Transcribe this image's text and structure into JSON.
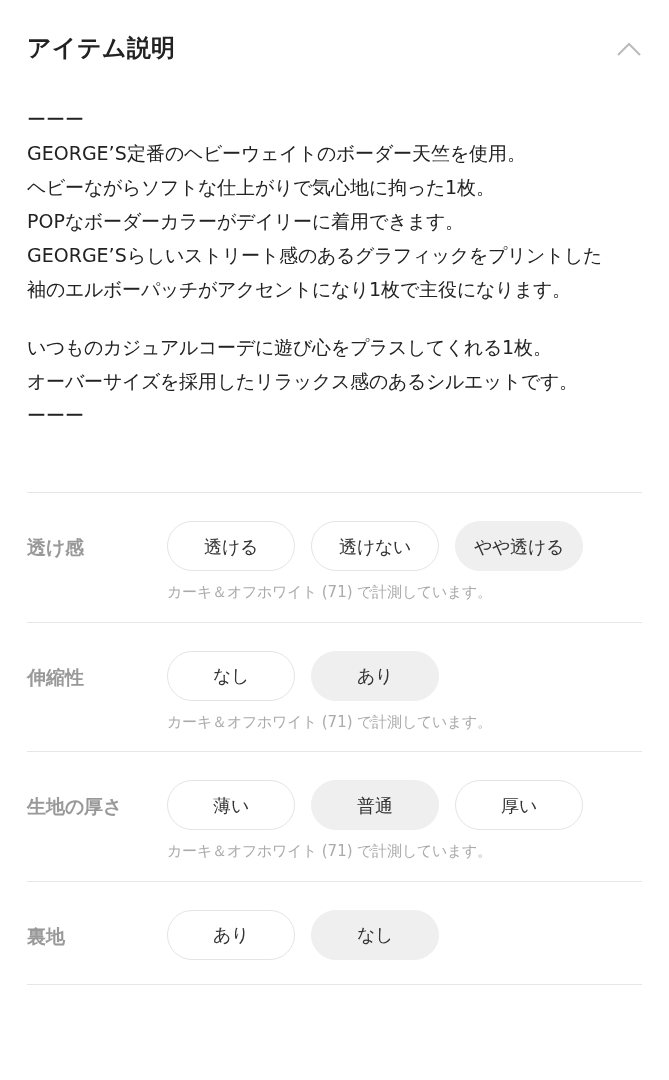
{
  "section": {
    "title": "アイテム説明",
    "expanded": true
  },
  "description": [
    [
      "ーーー",
      "GEORGE’S定番のヘビーウェイトのボーダー天竺を使用。",
      "ヘビーながらソフトな仕上がりで気心地に拘った1枚。",
      "POPなボーダーカラーがデイリーに着用できます。",
      "GEORGE’Sらしいストリート感のあるグラフィックをプリントした",
      "袖のエルボーパッチがアクセントになり1枚で主役になります。"
    ],
    [
      "いつものカジュアルコーデに遊び心をプラスしてくれる1枚。",
      "オーバーサイズを採用したリラックス感のあるシルエットです。",
      "ーーー"
    ]
  ],
  "attributes": [
    {
      "label": "透け感",
      "options": [
        {
          "label": "透ける",
          "selected": false
        },
        {
          "label": "透けない",
          "selected": false
        },
        {
          "label": "やや透ける",
          "selected": true
        }
      ],
      "note": "カーキ＆オフホワイト (71) で計測しています。"
    },
    {
      "label": "伸縮性",
      "options": [
        {
          "label": "なし",
          "selected": false
        },
        {
          "label": "あり",
          "selected": true
        }
      ],
      "note": "カーキ＆オフホワイト (71) で計測しています。"
    },
    {
      "label": "生地の厚さ",
      "options": [
        {
          "label": "薄い",
          "selected": false
        },
        {
          "label": "普通",
          "selected": true
        },
        {
          "label": "厚い",
          "selected": false
        }
      ],
      "note": "カーキ＆オフホワイト (71) で計測しています。"
    },
    {
      "label": "裏地",
      "options": [
        {
          "label": "あり",
          "selected": false
        },
        {
          "label": "なし",
          "selected": true
        }
      ]
    }
  ]
}
